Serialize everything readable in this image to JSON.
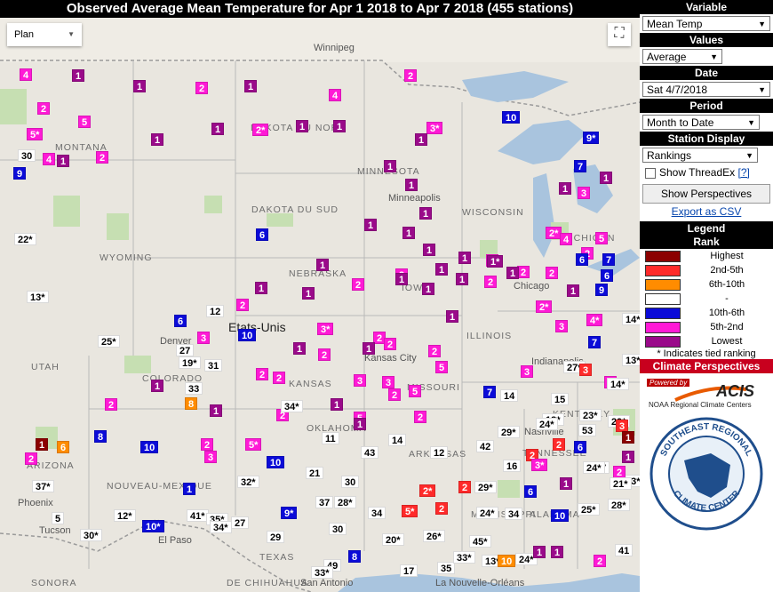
{
  "title": "Observed Average Mean Temperature for Apr 1 2018 to Apr 7 2018 (455 stations)",
  "map": {
    "maptype": "Plan",
    "labels": {
      "country": "Etats-Unis",
      "states": [
        "MONTANA",
        "DAKOTA DU NORD",
        "DAKOTA DU SUD",
        "MINNESOTA",
        "WISCONSIN",
        "MICHIGAN",
        "WYOMING",
        "NEBRASKA",
        "IOWA",
        "ILLINOIS",
        "KANSAS",
        "MISSOURI",
        "KENTUCKY",
        "TENNESSEE",
        "OKLAHOMA",
        "ARKANSAS",
        "MISSISSIPPI",
        "ALABAMA",
        "TEXAS",
        "NOUVEAU-MEXIQUE",
        "ARIZONA",
        "UTAH",
        "COLORADO",
        "SONORA",
        "DE CHIHUAHUA"
      ],
      "cities": [
        "Winnipeg",
        "Minneapolis",
        "Chicago",
        "Indianapolis",
        "Kansas City",
        "Nashville",
        "El Paso",
        "Phoenix",
        "Tucson",
        "San Antonio",
        "La Nouvelle-Orléans",
        "Denver"
      ]
    },
    "markers": [
      {
        "v": "4",
        "c": "c52"
      },
      {
        "v": "1",
        "c": "lowest"
      },
      {
        "v": "1",
        "c": "lowest"
      },
      {
        "v": "2",
        "c": "c52"
      },
      {
        "v": "1",
        "c": "lowest"
      },
      {
        "v": "4",
        "c": "c52"
      },
      {
        "v": "2",
        "c": "c52"
      },
      {
        "v": "2",
        "c": "c52"
      },
      {
        "v": "5",
        "c": "c52"
      },
      {
        "v": "5*",
        "c": "c52"
      },
      {
        "v": "1",
        "c": "lowest"
      },
      {
        "v": "1",
        "c": "lowest"
      },
      {
        "v": "2*",
        "c": "c52"
      },
      {
        "v": "1",
        "c": "lowest"
      },
      {
        "v": "1",
        "c": "lowest"
      },
      {
        "v": "3*",
        "c": "c52"
      },
      {
        "v": "1",
        "c": "lowest"
      },
      {
        "v": "10",
        "c": "c106"
      },
      {
        "v": "9*",
        "c": "c106"
      },
      {
        "v": "30",
        "c": "mid"
      },
      {
        "v": "4",
        "c": "c52"
      },
      {
        "v": "1",
        "c": "lowest"
      },
      {
        "v": "2",
        "c": "c52"
      },
      {
        "v": "9",
        "c": "c106"
      },
      {
        "v": "1",
        "c": "lowest"
      },
      {
        "v": "1",
        "c": "lowest"
      },
      {
        "v": "1",
        "c": "lowest"
      },
      {
        "v": "7",
        "c": "c106"
      },
      {
        "v": "1",
        "c": "lowest"
      },
      {
        "v": "3",
        "c": "c52"
      },
      {
        "v": "1",
        "c": "lowest"
      },
      {
        "v": "22*",
        "c": "mid"
      },
      {
        "v": "6",
        "c": "c106"
      },
      {
        "v": "1",
        "c": "lowest"
      },
      {
        "v": "1",
        "c": "lowest"
      },
      {
        "v": "2*",
        "c": "c52"
      },
      {
        "v": "4",
        "c": "c52"
      },
      {
        "v": "6",
        "c": "c106"
      },
      {
        "v": "5",
        "c": "c52"
      },
      {
        "v": "1",
        "c": "lowest"
      },
      {
        "v": "1",
        "c": "lowest"
      },
      {
        "v": "2",
        "c": "c52"
      },
      {
        "v": "2",
        "c": "c52"
      },
      {
        "v": "1",
        "c": "lowest"
      },
      {
        "v": "1*",
        "c": "lowest"
      },
      {
        "v": "2",
        "c": "c52"
      },
      {
        "v": "1",
        "c": "lowest"
      },
      {
        "v": "3",
        "c": "c52"
      },
      {
        "v": "6",
        "c": "c106"
      },
      {
        "v": "7",
        "c": "c106"
      },
      {
        "v": "1",
        "c": "lowest"
      },
      {
        "v": "2",
        "c": "c52"
      },
      {
        "v": "1",
        "c": "lowest"
      },
      {
        "v": "1",
        "c": "lowest"
      },
      {
        "v": "2",
        "c": "c52"
      },
      {
        "v": "1",
        "c": "lowest"
      },
      {
        "v": "2",
        "c": "c52"
      },
      {
        "v": "1",
        "c": "lowest"
      },
      {
        "v": "9",
        "c": "c106"
      },
      {
        "v": "6",
        "c": "c106"
      },
      {
        "v": "13*",
        "c": "mid"
      },
      {
        "v": "2",
        "c": "c52"
      },
      {
        "v": "1",
        "c": "lowest"
      },
      {
        "v": "1",
        "c": "lowest"
      },
      {
        "v": "2*",
        "c": "c52"
      },
      {
        "v": "12",
        "c": "mid"
      },
      {
        "v": "6",
        "c": "c106"
      },
      {
        "v": "25*",
        "c": "mid"
      },
      {
        "v": "3",
        "c": "c52"
      },
      {
        "v": "10",
        "c": "c106"
      },
      {
        "v": "3*",
        "c": "c52"
      },
      {
        "v": "1",
        "c": "lowest"
      },
      {
        "v": "2",
        "c": "c52"
      },
      {
        "v": "2",
        "c": "c52"
      },
      {
        "v": "3",
        "c": "c52"
      },
      {
        "v": "4*",
        "c": "c52"
      },
      {
        "v": "14*",
        "c": "mid"
      },
      {
        "v": "27",
        "c": "mid"
      },
      {
        "v": "19*",
        "c": "mid"
      },
      {
        "v": "31",
        "c": "mid"
      },
      {
        "v": "1",
        "c": "lowest"
      },
      {
        "v": "2",
        "c": "c52"
      },
      {
        "v": "1",
        "c": "lowest"
      },
      {
        "v": "2",
        "c": "c52"
      },
      {
        "v": "7",
        "c": "c106"
      },
      {
        "v": "13*",
        "c": "mid"
      },
      {
        "v": "2",
        "c": "c52"
      },
      {
        "v": "2",
        "c": "c52"
      },
      {
        "v": "3",
        "c": "c52"
      },
      {
        "v": "3",
        "c": "c52"
      },
      {
        "v": "5",
        "c": "c52"
      },
      {
        "v": "3",
        "c": "c52"
      },
      {
        "v": "27*",
        "c": "mid"
      },
      {
        "v": "3",
        "c": "c25"
      },
      {
        "v": "33",
        "c": "mid"
      },
      {
        "v": "1",
        "c": "lowest"
      },
      {
        "v": "3",
        "c": "c52"
      },
      {
        "v": "2",
        "c": "c52"
      },
      {
        "v": "5",
        "c": "c52"
      },
      {
        "v": "7",
        "c": "c106"
      },
      {
        "v": "14",
        "c": "mid"
      },
      {
        "v": "14*",
        "c": "mid"
      },
      {
        "v": "8",
        "c": "c610"
      },
      {
        "v": "15",
        "c": "mid"
      },
      {
        "v": "2",
        "c": "c52"
      },
      {
        "v": "1",
        "c": "lowest"
      },
      {
        "v": "1",
        "c": "lowest"
      },
      {
        "v": "2",
        "c": "c52"
      },
      {
        "v": "18*",
        "c": "mid"
      },
      {
        "v": "23*",
        "c": "mid"
      },
      {
        "v": "5",
        "c": "c52"
      },
      {
        "v": "1",
        "c": "lowest"
      },
      {
        "v": "2",
        "c": "c52"
      },
      {
        "v": "24*",
        "c": "mid"
      },
      {
        "v": "53",
        "c": "mid"
      },
      {
        "v": "29*",
        "c": "mid"
      },
      {
        "v": "3",
        "c": "c25"
      },
      {
        "v": "1",
        "c": "high"
      },
      {
        "v": "1",
        "c": "high"
      },
      {
        "v": "6",
        "c": "c610"
      },
      {
        "v": "8",
        "c": "c106"
      },
      {
        "v": "10",
        "c": "c106"
      },
      {
        "v": "2",
        "c": "c52"
      },
      {
        "v": "5*",
        "c": "c52"
      },
      {
        "v": "11",
        "c": "mid"
      },
      {
        "v": "14",
        "c": "mid"
      },
      {
        "v": "42",
        "c": "mid"
      },
      {
        "v": "29*",
        "c": "mid"
      },
      {
        "v": "2",
        "c": "c25"
      },
      {
        "v": "6",
        "c": "c106"
      },
      {
        "v": "1",
        "c": "lowest"
      },
      {
        "v": "2",
        "c": "c52"
      },
      {
        "v": "10",
        "c": "c106"
      },
      {
        "v": "43",
        "c": "mid"
      },
      {
        "v": "12",
        "c": "mid"
      },
      {
        "v": "34*",
        "c": "mid"
      },
      {
        "v": "2",
        "c": "c25"
      },
      {
        "v": "17",
        "c": "mid"
      },
      {
        "v": "3",
        "c": "c52"
      },
      {
        "v": "16",
        "c": "mid"
      },
      {
        "v": "23*",
        "c": "mid"
      },
      {
        "v": "37*",
        "c": "mid"
      },
      {
        "v": "32*",
        "c": "mid"
      },
      {
        "v": "21",
        "c": "mid"
      },
      {
        "v": "3*",
        "c": "c52"
      },
      {
        "v": "24*",
        "c": "mid"
      },
      {
        "v": "2",
        "c": "c52"
      },
      {
        "v": "21*",
        "c": "mid"
      },
      {
        "v": "1",
        "c": "c106"
      },
      {
        "v": "30",
        "c": "mid"
      },
      {
        "v": "2*",
        "c": "c25"
      },
      {
        "v": "2",
        "c": "c25"
      },
      {
        "v": "29*",
        "c": "mid"
      },
      {
        "v": "6",
        "c": "c106"
      },
      {
        "v": "1",
        "c": "lowest"
      },
      {
        "v": "5",
        "c": "mid"
      },
      {
        "v": "12*",
        "c": "mid"
      },
      {
        "v": "41*",
        "c": "mid"
      },
      {
        "v": "35*",
        "c": "mid"
      },
      {
        "v": "27",
        "c": "mid"
      },
      {
        "v": "37",
        "c": "mid"
      },
      {
        "v": "31*",
        "c": "mid"
      },
      {
        "v": "28*",
        "c": "mid"
      },
      {
        "v": "34",
        "c": "mid"
      },
      {
        "v": "5*",
        "c": "c25"
      },
      {
        "v": "2",
        "c": "c25"
      },
      {
        "v": "24*",
        "c": "mid"
      },
      {
        "v": "34",
        "c": "mid"
      },
      {
        "v": "10",
        "c": "c106"
      },
      {
        "v": "25*",
        "c": "mid"
      },
      {
        "v": "28*",
        "c": "mid"
      },
      {
        "v": "30*",
        "c": "mid"
      },
      {
        "v": "10*",
        "c": "c106"
      },
      {
        "v": "34*",
        "c": "mid"
      },
      {
        "v": "9*",
        "c": "c106"
      },
      {
        "v": "30",
        "c": "mid"
      },
      {
        "v": "29",
        "c": "mid"
      },
      {
        "v": "20*",
        "c": "mid"
      },
      {
        "v": "26*",
        "c": "mid"
      },
      {
        "v": "45*",
        "c": "mid"
      },
      {
        "v": "41",
        "c": "mid"
      },
      {
        "v": "8",
        "c": "c106"
      },
      {
        "v": "49",
        "c": "mid"
      },
      {
        "v": "33*",
        "c": "mid"
      },
      {
        "v": "17",
        "c": "mid"
      },
      {
        "v": "35",
        "c": "mid"
      },
      {
        "v": "33*",
        "c": "mid"
      },
      {
        "v": "13*",
        "c": "mid"
      },
      {
        "v": "10",
        "c": "c610"
      },
      {
        "v": "24*",
        "c": "mid"
      },
      {
        "v": "1",
        "c": "lowest"
      },
      {
        "v": "1",
        "c": "lowest"
      },
      {
        "v": "2",
        "c": "c52"
      }
    ]
  },
  "panel": {
    "variable_header": "Variable",
    "variable_value": "Mean Temp",
    "values_header": "Values",
    "values_value": "Average",
    "date_header": "Date",
    "date_value": "Sat 4/7/2018",
    "period_header": "Period",
    "period_value": "Month to Date",
    "station_header": "Station Display",
    "station_value": "Rankings",
    "threadex_label": "Show ThreadEx",
    "threadex_help": "[?]",
    "perspectives_button": "Show Perspectives",
    "export_link": "Export as CSV",
    "legend_title": "Legend",
    "rank_title": "Rank",
    "legend": [
      {
        "label": "Highest",
        "color": "#8b0000"
      },
      {
        "label": "2nd-5th",
        "color": "#ff2a2a"
      },
      {
        "label": "6th-10th",
        "color": "#ff8c00"
      },
      {
        "label": "-",
        "color": "#ffffff"
      },
      {
        "label": "10th-6th",
        "color": "#0b0bd8"
      },
      {
        "label": "5th-2nd",
        "color": "#ff1ad6"
      },
      {
        "label": "Lowest",
        "color": "#9a0a8a"
      }
    ],
    "tie_note": "* Indicates tied ranking",
    "climate_header": "Climate Perspectives",
    "powered_by": "Powered by",
    "acis_logo": "ACIS",
    "acis_sub": "NOAA Regional Climate Centers",
    "seal_top": "SOUTHEAST REGIONAL",
    "seal_bottom": "CLIMATE CENTER"
  }
}
